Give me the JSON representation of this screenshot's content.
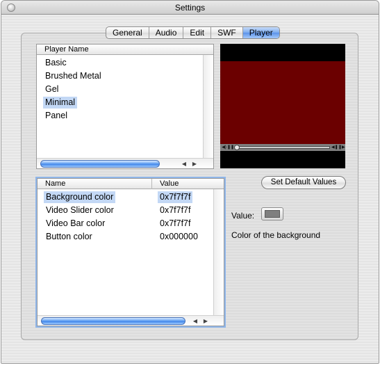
{
  "window": {
    "title": "Settings"
  },
  "tabs": [
    {
      "label": "General",
      "selected": false
    },
    {
      "label": "Audio",
      "selected": false
    },
    {
      "label": "Edit",
      "selected": false
    },
    {
      "label": "SWF",
      "selected": false
    },
    {
      "label": "Player",
      "selected": true
    }
  ],
  "player_list": {
    "header": "Player Name",
    "items": [
      "Basic",
      "Brushed Metal",
      "Gel",
      "Minimal",
      "Panel"
    ],
    "selected": "Minimal"
  },
  "properties": {
    "headers": {
      "name": "Name",
      "value": "Value"
    },
    "rows": [
      {
        "name": "Background color",
        "value": "0x7f7f7f"
      },
      {
        "name": "Video Slider color",
        "value": "0x7f7f7f"
      },
      {
        "name": "Video Bar color",
        "value": "0x7f7f7f"
      },
      {
        "name": "Button color",
        "value": "0x000000"
      }
    ],
    "selected": "Background color"
  },
  "buttons": {
    "set_default": "Set Default Values"
  },
  "value_panel": {
    "label": "Value:",
    "swatch_color": "#7f7f7f",
    "description": "Color of the background"
  },
  "preview": {
    "background_color": "#000000",
    "frame_color": "#6b0000",
    "controller_color": "#7f7f7f"
  }
}
